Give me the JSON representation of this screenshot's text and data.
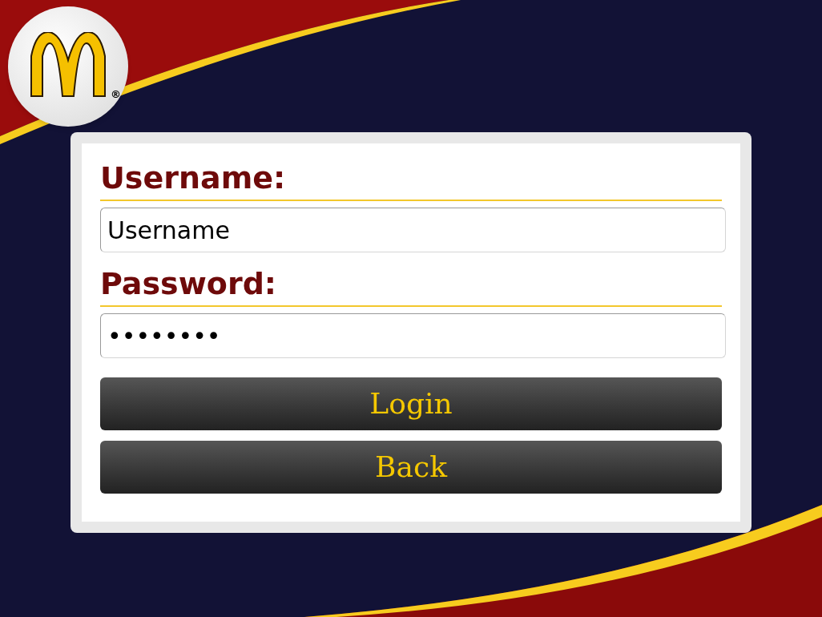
{
  "logo": {
    "mark": "®"
  },
  "form": {
    "fields": [
      {
        "label": "Username:",
        "value": "Username"
      },
      {
        "label": "Password:",
        "value": "••••••••"
      }
    ],
    "buttons": [
      "Login",
      "Back"
    ]
  }
}
